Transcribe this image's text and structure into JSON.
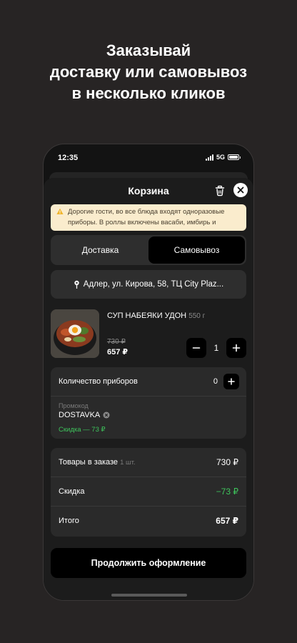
{
  "headline": {
    "line1": "Заказывай",
    "line2": "доставку или самовывоз",
    "line3": "в несколько кликов"
  },
  "status_bar": {
    "time": "12:35",
    "network": "5G"
  },
  "cart": {
    "title": "Корзина",
    "warning": "Дорогие гости, во все блюда входят одноразовые приборы. В роллы включены васаби, имбирь и"
  },
  "tabs": [
    {
      "label": "Доставка",
      "active": false
    },
    {
      "label": "Самовывоз",
      "active": true
    }
  ],
  "address": {
    "text": "Адлер, ул. Кирова, 58, ТЦ City Plaz..."
  },
  "item": {
    "name": "СУП НАБЕЯКИ УДОН",
    "weight": "550 г",
    "old_price": "730 ₽",
    "new_price": "657 ₽",
    "quantity": "1"
  },
  "cutlery": {
    "label": "Количество приборов",
    "value": "0"
  },
  "promo": {
    "label": "Промокод",
    "code": "DOSTAVKA",
    "discount": "Скидка — 73 ₽"
  },
  "summary": {
    "items_label": "Товары в заказе",
    "items_count": "1 шт.",
    "items_value": "730 ₽",
    "discount_label": "Скидка",
    "discount_value": "−73 ₽",
    "total_label": "Итого",
    "total_value": "657 ₽"
  },
  "cta": {
    "label": "Продолжить оформление"
  },
  "colors": {
    "background": "#272424",
    "sheet": "#1c1c1c",
    "card": "#2a2a2a",
    "warning_bg": "#faeccd",
    "accent_green": "#3ec45c"
  }
}
